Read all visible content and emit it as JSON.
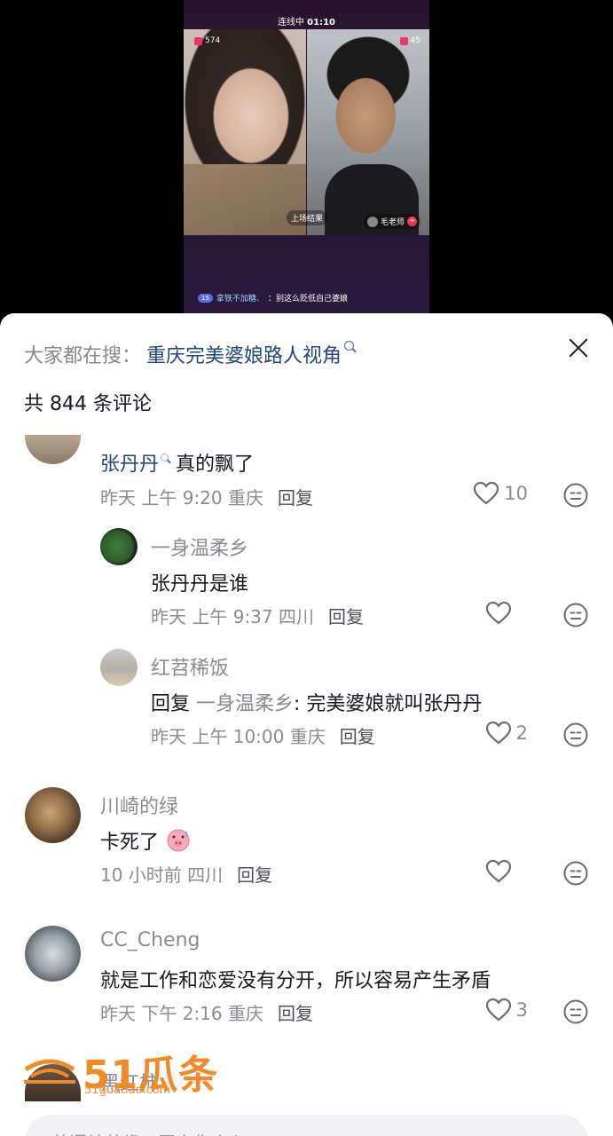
{
  "live": {
    "timer_prefix": "连线中",
    "timer_value": "01:10",
    "score_left": "574",
    "score_right": "45",
    "cam_caption": "上场结果",
    "host_name": "毛老师",
    "comment_level": "15",
    "comment_user": "拿铁不加糖、",
    "comment_text": "：别这么贬低自己婆娘"
  },
  "sheet": {
    "search_prefix": "大家都在搜：",
    "search_keyword": "重庆完美婆娘路人视角",
    "comment_count": "共 844 条评论",
    "close_label": "close"
  },
  "comments": [
    {
      "id": "c1",
      "user": "",
      "mention": "张丹丹",
      "text": "真的飘了",
      "time": "昨天 上午 9:20 重庆",
      "reply_label": "回复",
      "likes": "10"
    },
    {
      "id": "c1r1",
      "user": "一身温柔乡",
      "text": "张丹丹是谁",
      "time": "昨天 上午 9:37 四川",
      "reply_label": "回复",
      "likes": ""
    },
    {
      "id": "c1r2",
      "user": "红苕稀饭",
      "reply_prefix": "回复 ",
      "reply_to": "一身温柔乡",
      "text": ": 完美婆娘就叫张丹丹",
      "time": "昨天 上午 10:00 重庆",
      "reply_label": "回复",
      "likes": "2"
    },
    {
      "id": "c2",
      "user": "川崎的绿",
      "text": "卡死了",
      "time": "10 小时前 四川",
      "reply_label": "回复",
      "likes": ""
    },
    {
      "id": "c3",
      "user": "CC_Cheng",
      "text": "就是工作和恋爱没有分开，所以容易产生矛盾",
      "time": "昨天 下午 2:16 重庆",
      "reply_label": "回复",
      "likes": "3"
    }
  ],
  "partial_user": "黑红柿",
  "watermark": {
    "main": "51瓜条",
    "sub": "51guatiao.com"
  },
  "input": {
    "placeholder": "善语结善缘，恶言伤人心"
  },
  "colors": {
    "accent_keyword": "#26467a",
    "watermark": "#f28a2a",
    "like_red": "#fe2c55"
  },
  "icons": [
    "close-icon",
    "search-icon",
    "heart-icon",
    "emoji-icon"
  ]
}
